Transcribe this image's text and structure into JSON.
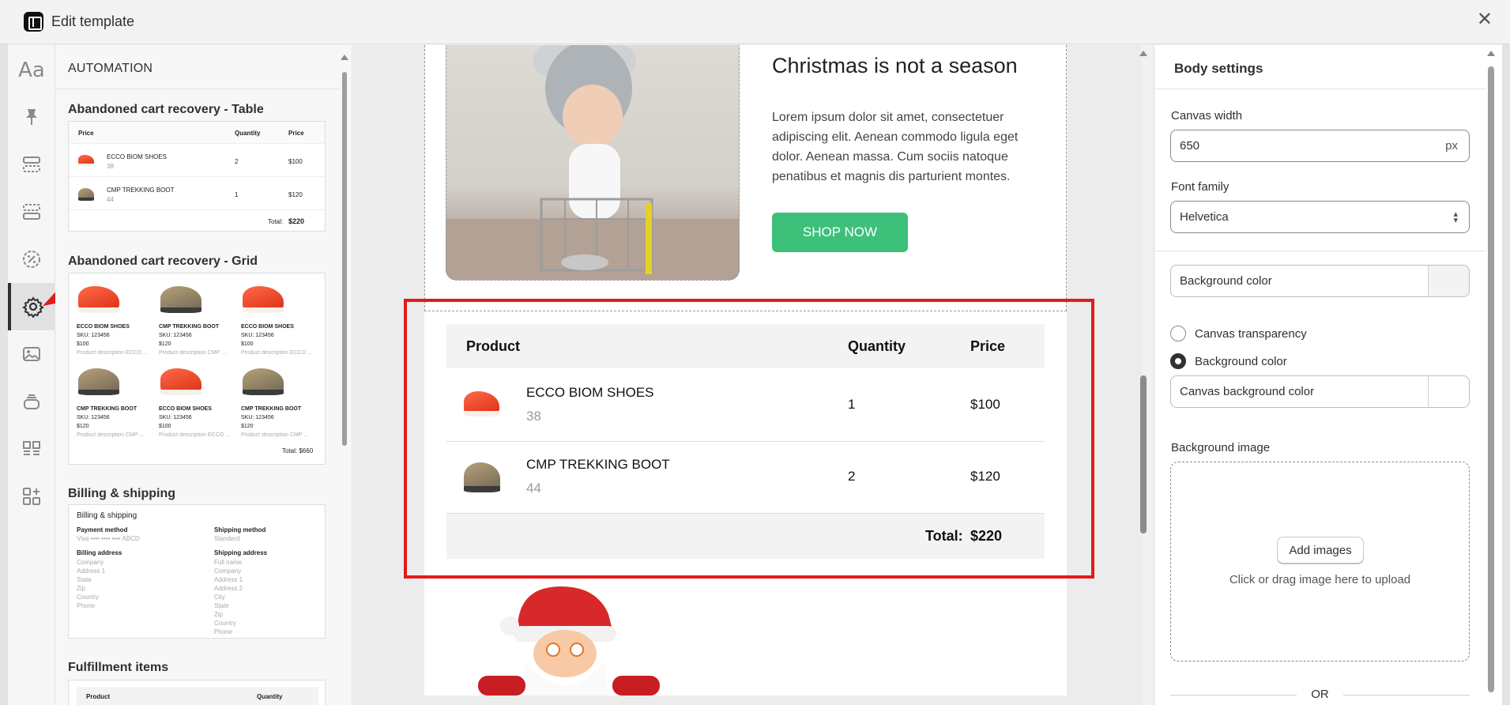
{
  "header": {
    "title": "Edit template",
    "close_icon": "close-icon"
  },
  "rail": {
    "items": [
      "typography-icon",
      "pin-icon",
      "layout-top-icon",
      "layout-bottom-icon",
      "discount-icon",
      "gear-icon",
      "image-icon",
      "stack-icon",
      "grid-icon",
      "add-apps-icon"
    ],
    "active": "gear-icon"
  },
  "templates": {
    "heading": "AUTOMATION",
    "table": {
      "title": "Abandoned cart recovery - Table",
      "headers": [
        "Price",
        "Quantity",
        "Price"
      ],
      "rows": [
        {
          "name": "ECCO BIOM SHOES",
          "size": "38",
          "qty": "2",
          "price": "$100"
        },
        {
          "name": "CMP TREKKING BOOT",
          "size": "44",
          "qty": "1",
          "price": "$120"
        }
      ],
      "total_label": "Total:",
      "total": "$220"
    },
    "grid": {
      "title": "Abandoned cart recovery - Grid",
      "items": [
        {
          "name": "ECCO BIOM SHOES",
          "sku": "SKU: 123456",
          "price": "$100",
          "desc": "Product description ECCO ..."
        },
        {
          "name": "CMP TREKKING BOOT",
          "sku": "SKU: 123456",
          "price": "$120",
          "desc": "Product description CMP ..."
        },
        {
          "name": "ECCO BIOM SHOES",
          "sku": "SKU: 123456",
          "price": "$100",
          "desc": "Product description ECCO ..."
        },
        {
          "name": "CMP TREKKING BOOT",
          "sku": "SKU: 123456",
          "price": "$120",
          "desc": "Product description CMP ..."
        },
        {
          "name": "ECCO BIOM SHOES",
          "sku": "SKU: 123456",
          "price": "$100",
          "desc": "Product description ECCO ..."
        },
        {
          "name": "CMP TREKKING BOOT",
          "sku": "SKU: 123456",
          "price": "$120",
          "desc": "Product description CMP ..."
        }
      ],
      "total": "Total: $660"
    },
    "billing": {
      "title": "Billing & shipping",
      "card_title": "Billing & shipping",
      "payment_label": "Payment method",
      "payment_value": "Visa •••• •••• •••• ABCD",
      "shipping_label": "Shipping method",
      "shipping_value": "Standard",
      "billing_addr_label": "Billing address",
      "billing_addr": [
        "Company",
        "Address 1",
        "State",
        "Zip",
        "Country",
        "Phone"
      ],
      "shipping_addr_label": "Shipping address",
      "shipping_addr": [
        "Full name",
        "Company",
        "Address 1",
        "Address 2",
        "City",
        "State",
        "Zip",
        "Country",
        "Phone"
      ]
    },
    "fulfillment": {
      "title": "Fulfillment items",
      "headers": [
        "Product",
        "Quantity"
      ]
    }
  },
  "email": {
    "hero_title": "Christmas is not a season",
    "hero_text": "Lorem ipsum dolor sit amet, consectetuer adipiscing elit. Aenean commodo ligula eget dolor. Aenean massa. Cum sociis natoque penatibus et magnis dis parturient montes.",
    "cta": "SHOP NOW",
    "cta_color": "#3cc07a",
    "table": {
      "headers": {
        "product": "Product",
        "quantity": "Quantity",
        "price": "Price"
      },
      "rows": [
        {
          "name": "ECCO BIOM SHOES",
          "size": "38",
          "qty": "1",
          "price": "$100"
        },
        {
          "name": "CMP TREKKING BOOT",
          "size": "44",
          "qty": "2",
          "price": "$120"
        }
      ],
      "total_label": "Total:",
      "total": "$220"
    },
    "highlight_color": "#e21b1b"
  },
  "settings": {
    "title": "Body settings",
    "canvas_width_label": "Canvas width",
    "canvas_width": "650",
    "canvas_width_unit": "px",
    "font_family_label": "Font family",
    "font_family": "Helvetica",
    "bg_color_field": "Background color",
    "radio_transparency": "Canvas transparency",
    "radio_bg": "Background color",
    "radio_selected": "Background color",
    "canvas_bg_field": "Canvas background color",
    "bg_image_label": "Background image",
    "add_images": "Add images",
    "drop_hint": "Click or drag image here to upload",
    "or": "OR"
  }
}
